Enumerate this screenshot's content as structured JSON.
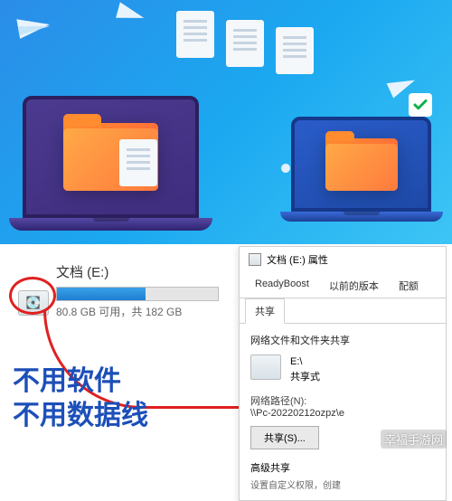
{
  "hero": {
    "checkmark_icon": "checkmark"
  },
  "drive": {
    "title": "文档 (E:)",
    "usage_text": "80.8 GB 可用，共 182 GB",
    "used_percent": 55
  },
  "slogan": {
    "line1": "不用软件",
    "line2": "不用数据线"
  },
  "props": {
    "window_title": "文档 (E:) 属性",
    "tabs": [
      {
        "label": "ReadyBoost",
        "active": false
      },
      {
        "label": "以前的版本",
        "active": false
      },
      {
        "label": "配额",
        "active": false
      },
      {
        "label": "共享",
        "active": true
      }
    ],
    "section_label": "网络文件和文件夹共享",
    "share_name": "E:\\",
    "share_status": "共享式",
    "path_label": "网络路径(N):",
    "path_value": "\\\\Pc-20220212ozpz\\e",
    "share_button": "共享(S)...",
    "advanced_label": "高级共享",
    "advanced_sub": "设置自定义权限，创建"
  },
  "watermark": "幸福手游网"
}
